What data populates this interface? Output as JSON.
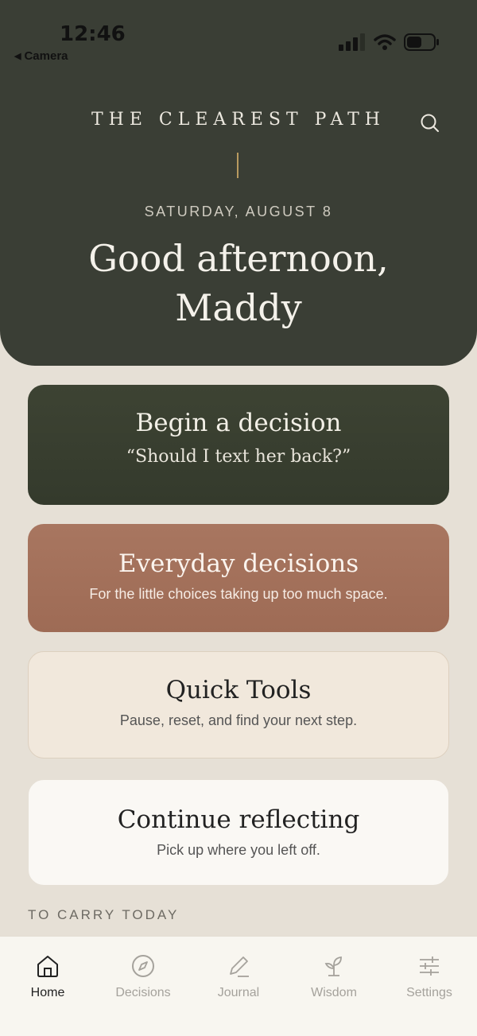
{
  "status_bar": {
    "time": "12:46",
    "back_label": "Camera"
  },
  "header": {
    "brand": "THE CLEAREST PATH",
    "date": "SATURDAY, AUGUST 8",
    "greeting_line1": "Good afternoon,",
    "greeting_line2": "Maddy"
  },
  "cards": [
    {
      "title": "Begin a decision",
      "subtitle": "“Should I text her back?”"
    },
    {
      "title": "Everyday decisions",
      "subtitle": "For the little choices taking up too much space."
    },
    {
      "title": "Quick Tools",
      "subtitle": "Pause, reset, and find your next step."
    },
    {
      "title": "Continue reflecting",
      "subtitle": "Pick up where you left off."
    }
  ],
  "section": {
    "label": "TO CARRY TODAY"
  },
  "tabs": [
    {
      "label": "Home",
      "icon": "home-icon",
      "active": true
    },
    {
      "label": "Decisions",
      "icon": "compass-icon",
      "active": false
    },
    {
      "label": "Journal",
      "icon": "pencil-icon",
      "active": false
    },
    {
      "label": "Wisdom",
      "icon": "sprout-icon",
      "active": false
    },
    {
      "label": "Settings",
      "icon": "sliders-icon",
      "active": false
    }
  ],
  "colors": {
    "header_bg": "#3a3e35",
    "accent_gold": "#b89a5f",
    "card_green": "#3a4030",
    "card_terracotta": "#a57260",
    "card_cream": "#f1e8dc",
    "card_white": "#faf8f4"
  }
}
